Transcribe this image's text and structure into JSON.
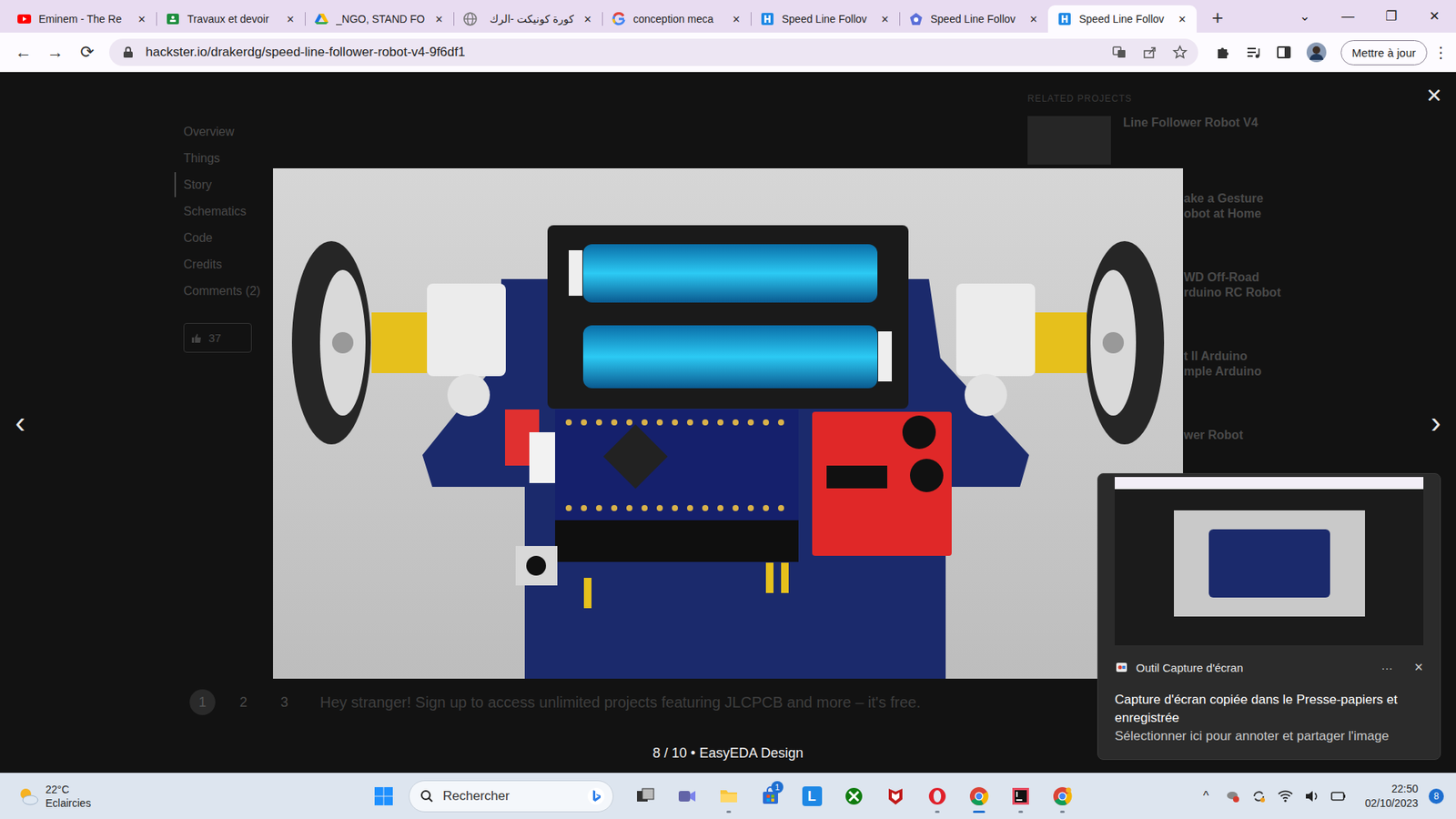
{
  "browser": {
    "tabs": [
      {
        "label": "Eminem - The Re",
        "kind": "youtube",
        "selected": false
      },
      {
        "label": "Travaux et devoir",
        "kind": "classroom",
        "selected": false
      },
      {
        "label": "_NGO, STAND FO",
        "kind": "drive",
        "selected": false
      },
      {
        "label": "كورة كونيكت -الرك",
        "kind": "globe",
        "selected": false
      },
      {
        "label": "conception meca",
        "kind": "google",
        "selected": false
      },
      {
        "label": "Speed Line Follov",
        "kind": "hackster",
        "selected": false
      },
      {
        "label": "Speed Line Follov",
        "kind": "hackster-alt",
        "selected": false
      },
      {
        "label": "Speed Line Follov",
        "kind": "hackster",
        "selected": true
      }
    ],
    "tab_close": "✕",
    "new_tab": "+",
    "window_controls": [
      "⌄",
      "—",
      "❐",
      "✕"
    ],
    "nav_buttons": [
      "←",
      "→",
      "⟳"
    ],
    "address": "hackster.io/drakerdg/speed-line-follower-robot-v4-9f6df1",
    "update_button": "Mettre à jour",
    "menu": "⋮"
  },
  "page": {
    "nav": [
      {
        "label": "Overview",
        "selected": false
      },
      {
        "label": "Things",
        "selected": false
      },
      {
        "label": "Story",
        "selected": true
      },
      {
        "label": "Schematics",
        "selected": false
      },
      {
        "label": "Code",
        "selected": false
      },
      {
        "label": "Credits",
        "selected": false
      },
      {
        "label": "Comments (2)",
        "selected": false
      }
    ],
    "respect_count": "37",
    "pagination": [
      {
        "label": "1",
        "selected": true
      },
      {
        "label": "2",
        "selected": false
      },
      {
        "label": "3",
        "selected": false
      }
    ],
    "signup_banner": "Hey stranger! Sign up to access unlimited projects featuring JLCPCB and more – it's free.",
    "related": {
      "heading": "RELATED PROJECTS",
      "items": [
        {
          "lines": [
            "Line Follower Robot V4"
          ]
        },
        {
          "lines": [
            "ake a Gesture",
            "obot at Home"
          ]
        },
        {
          "lines": [
            "WD Off-Road",
            "rduino RC Robot"
          ]
        },
        {
          "lines": [
            "t ll Arduino",
            "mple Arduino"
          ]
        },
        {
          "lines": [
            "wer Robot"
          ]
        }
      ]
    }
  },
  "lightbox": {
    "caption": "8 / 10 • EasyEDA Design",
    "prev": "‹",
    "next": "›",
    "close": "✕"
  },
  "toast": {
    "app": "Outil Capture d'écran",
    "more": "···",
    "close": "✕",
    "title": "Capture d'écran copiée dans le Presse-papiers et enregistrée",
    "subtitle": "Sélectionner ici pour annoter et partager l'image"
  },
  "taskbar": {
    "weather": {
      "temp": "22°C",
      "condition": "Eclaircies"
    },
    "search": {
      "placeholder": "Rechercher"
    },
    "apps": [
      {
        "kind": "taskview",
        "running": false,
        "selected": false
      },
      {
        "kind": "meet",
        "running": false,
        "selected": false
      },
      {
        "kind": "explorer",
        "running": true,
        "selected": false
      },
      {
        "kind": "store",
        "running": false,
        "selected": false,
        "badge": "1"
      },
      {
        "kind": "letter",
        "label": "L",
        "running": false,
        "selected": false
      },
      {
        "kind": "xbox",
        "running": false,
        "selected": false
      },
      {
        "kind": "mcafee",
        "running": false,
        "selected": false
      },
      {
        "kind": "opera",
        "running": true,
        "selected": false
      },
      {
        "kind": "chrome",
        "running": true,
        "selected": true
      },
      {
        "kind": "intellij",
        "running": true,
        "selected": false
      },
      {
        "kind": "chrome-dev",
        "running": true,
        "selected": false
      }
    ],
    "tray": {
      "overflow": "^",
      "time": "22:50",
      "date": "02/10/2023",
      "notifications": "8"
    }
  }
}
